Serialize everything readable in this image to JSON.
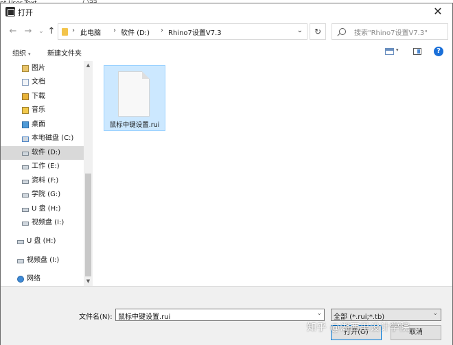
{
  "background_window": {
    "text_fragment": "nt User Text",
    "text_fragment2": "(,)∃∃"
  },
  "window": {
    "title": "打开",
    "close_glyph": "✕"
  },
  "nav": {
    "back_glyph": "←",
    "forward_glyph": "→",
    "recent_glyph": "⌄",
    "up_glyph": "↑",
    "breadcrumbs": [
      "此电脑",
      "软件 (D:)",
      "Rhino7设置V7.3"
    ],
    "separator": "›",
    "dropdown_glyph": "⌄",
    "refresh_glyph": "↻",
    "search_placeholder": "搜索\"Rhino7设置V7.3\""
  },
  "toolbar": {
    "organize_label": "组织",
    "organize_caret": "▾",
    "new_folder_label": "新建文件夹",
    "view_caret": "▾",
    "help_glyph": "?"
  },
  "sidebar": {
    "items": [
      {
        "label": "图片",
        "icon": "pictures-icon",
        "selected": false
      },
      {
        "label": "文档",
        "icon": "documents-icon",
        "selected": false
      },
      {
        "label": "下载",
        "icon": "downloads-icon",
        "selected": false
      },
      {
        "label": "音乐",
        "icon": "music-icon",
        "selected": false
      },
      {
        "label": "桌面",
        "icon": "desktop-icon",
        "selected": false
      },
      {
        "label": "本地磁盘 (C:)",
        "icon": "system-drive-icon",
        "selected": false
      },
      {
        "label": "软件 (D:)",
        "icon": "drive-icon",
        "selected": true
      },
      {
        "label": "工作 (E:)",
        "icon": "drive-icon",
        "selected": false
      },
      {
        "label": "资料 (F:)",
        "icon": "drive-icon",
        "selected": false
      },
      {
        "label": "学院 (G:)",
        "icon": "drive-icon",
        "selected": false
      },
      {
        "label": "U 盘 (H:)",
        "icon": "drive-icon",
        "selected": false
      },
      {
        "label": "视频盘 (I:)",
        "icon": "drive-icon",
        "selected": false
      },
      {
        "label": "U 盘 (H:)",
        "icon": "drive-icon",
        "selected": false
      },
      {
        "label": "视频盘 (I:)",
        "icon": "drive-icon",
        "selected": false
      },
      {
        "label": "网络",
        "icon": "network-icon",
        "selected": false
      }
    ],
    "scroll_up_glyph": "▲",
    "scroll_down_glyph": "▼"
  },
  "files": [
    {
      "name": "鼠标中键设置.rui",
      "selected": true
    }
  ],
  "footer": {
    "filename_label": "文件名(N):",
    "filename_value": "鼠标中键设置.rui",
    "filename_dropdown_glyph": "⌄",
    "filetype_value": "全部 (*.rui;*.tb)",
    "filetype_dropdown_glyph": "⌄",
    "open_button": "打开(O)",
    "cancel_button": "取消"
  },
  "watermark": "知乎 @湖西里设计学院",
  "colors": {
    "selection_bg": "#cce8ff",
    "selection_border": "#99d1ff",
    "sidebar_selected_bg": "#d9d9d9",
    "footer_bg": "#f0f0f0",
    "accent": "#0078d7"
  }
}
